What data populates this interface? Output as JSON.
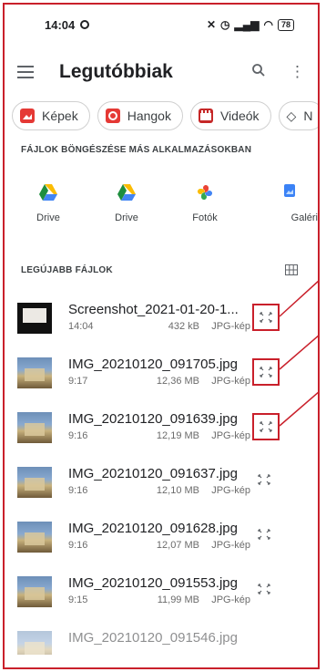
{
  "status_bar": {
    "time": "14:04",
    "battery": "78"
  },
  "app_bar": {
    "title": "Legutóbbiak"
  },
  "chips": [
    {
      "label": "Képek",
      "icon": "image-icon",
      "color": "#e53935"
    },
    {
      "label": "Hangok",
      "icon": "audio-icon",
      "color": "#e53935"
    },
    {
      "label": "Videók",
      "icon": "video-icon",
      "color": "#c62828"
    },
    {
      "label": "N",
      "icon": "tag-icon",
      "color": "#3c4043"
    }
  ],
  "browse_section": {
    "title": "FÁJLOK BÖNGÉSZÉSE MÁS ALKALMAZÁSOKBAN",
    "apps": [
      {
        "label": "Drive",
        "icon": "drive-icon"
      },
      {
        "label": "Drive",
        "icon": "drive-icon"
      },
      {
        "label": "Fotók",
        "icon": "photos-icon"
      },
      {
        "label": "Galéri",
        "icon": "gallery-icon"
      }
    ]
  },
  "recent_section": {
    "title": "LEGÚJABB FÁJLOK",
    "view_toggle": "grid-view-icon"
  },
  "files": [
    {
      "name": "Screenshot_2021-01-20-1...",
      "time": "14:04",
      "size": "432 kB",
      "kind": "JPG-kép",
      "thumb": "screenshot"
    },
    {
      "name": "IMG_20210120_091705.jpg",
      "time": "9:17",
      "size": "12,36 MB",
      "kind": "JPG-kép",
      "thumb": "photo"
    },
    {
      "name": "IMG_20210120_091639.jpg",
      "time": "9:16",
      "size": "12,19 MB",
      "kind": "JPG-kép",
      "thumb": "photo"
    },
    {
      "name": "IMG_20210120_091637.jpg",
      "time": "9:16",
      "size": "12,10 MB",
      "kind": "JPG-kép",
      "thumb": "photo"
    },
    {
      "name": "IMG_20210120_091628.jpg",
      "time": "9:16",
      "size": "12,07 MB",
      "kind": "JPG-kép",
      "thumb": "photo"
    },
    {
      "name": "IMG_20210120_091553.jpg",
      "time": "9:15",
      "size": "11,99 MB",
      "kind": "JPG-kép",
      "thumb": "photo"
    },
    {
      "name": "IMG_20210120_091546.jpg",
      "time": "",
      "size": "",
      "kind": "",
      "thumb": "photo"
    }
  ],
  "colors": {
    "highlight": "#c9202b",
    "drive_green": "#1e8e3e",
    "drive_yellow": "#fbbc04",
    "drive_blue": "#4285f4"
  }
}
